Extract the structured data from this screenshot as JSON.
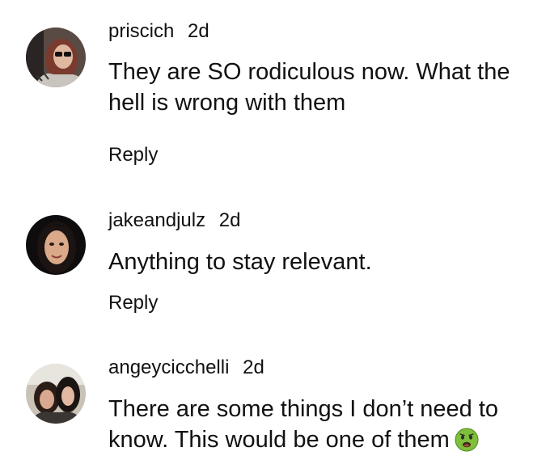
{
  "comments": [
    {
      "username": "priscich",
      "age": "2d",
      "text": "They are SO rodiculous now. What the hell is wrong with them",
      "reply_label": "Reply"
    },
    {
      "username": "jakeandjulz",
      "age": "2d",
      "text": "Anything to stay relevant.",
      "reply_label": "Reply"
    },
    {
      "username": "angeycicchelli",
      "age": "2d",
      "text": "There are some things I don’t need to know. This would be one of them",
      "emoji": "nauseated-face-icon"
    }
  ]
}
